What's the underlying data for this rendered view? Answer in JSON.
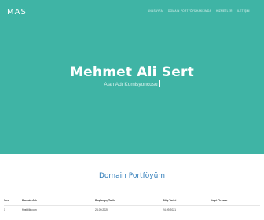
{
  "brand": {
    "logo": "MAS"
  },
  "nav": {
    "items": [
      "ANASAYFA",
      "DOMAIN PORTFÖYÜ",
      "HAKKIMDA",
      "HİZMETLER",
      "İLETİŞİM"
    ]
  },
  "hero": {
    "title": "Mehmet Ali Sert",
    "subtitle": "Alan Adı Komisyoncusu"
  },
  "portfolio": {
    "title": "Domain Portföyüm",
    "columns": [
      "Sıra",
      "Domain Adı",
      "Başlangıç Tarihi",
      "Bitiş Tarihi",
      "Kayıt Firması"
    ],
    "rows": [
      [
        "1",
        "fiyatbilir.com",
        "24.09.2020",
        "24.09.2021",
        ""
      ]
    ]
  },
  "colors": {
    "hero_bg": "#3fb4a5",
    "section_title": "#2e7bb8"
  }
}
